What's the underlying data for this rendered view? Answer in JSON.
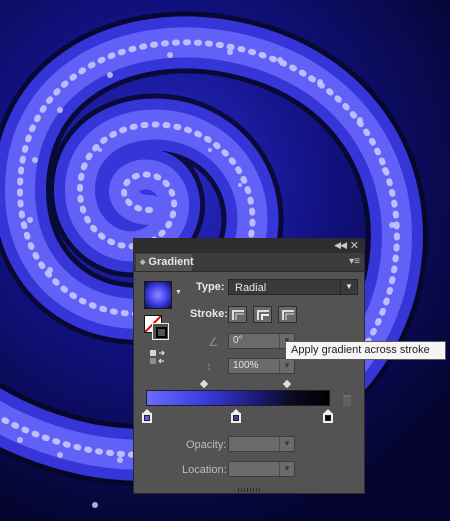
{
  "panel": {
    "tab_label": "Gradient",
    "type_label": "Type:",
    "type_value": "Radial",
    "stroke_label": "Stroke:",
    "angle_value": "0°",
    "aspect_value": "100%",
    "opacity_label": "Opacity:",
    "opacity_value": "",
    "location_label": "Location:",
    "location_value": ""
  },
  "gradient": {
    "stops": [
      {
        "color": "#5a5ae8",
        "location": 0
      },
      {
        "color": "#3d3d9a",
        "location": 0.49
      },
      {
        "color": "#000000",
        "location": 1
      }
    ],
    "midpoints": [
      0.31,
      0.76
    ]
  },
  "tooltip": {
    "text": "Apply gradient across stroke"
  },
  "icons": {
    "collapse": "double-chevron-left-icon",
    "close": "close-icon",
    "panel_menu": "panel-menu-icon",
    "reverse": "reverse-gradient-icon",
    "trash": "trash-icon",
    "angle": "angle-icon",
    "aspect": "aspect-ratio-icon"
  },
  "colors": {
    "panel_bg": "#535353",
    "artwork_bg": "#0a0a52",
    "spiral": "#4b4bff"
  }
}
